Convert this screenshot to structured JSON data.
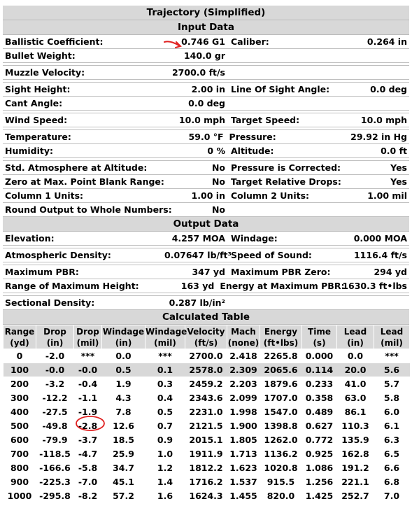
{
  "title": "Trajectory (Simplified)",
  "input": {
    "header": "Input Data",
    "rows": [
      [
        "Ballistic Coefficient:",
        "0.746 G1",
        "Caliber:",
        "0.264 in"
      ],
      [
        "Bullet Weight:",
        "140.0 gr",
        "",
        ""
      ],
      [
        "Muzzle Velocity:",
        "2700.0 ft/s",
        "",
        ""
      ],
      [
        "Sight Height:",
        "2.00 in",
        "Line Of Sight Angle:",
        "0.0 deg"
      ],
      [
        "Cant Angle:",
        "0.0 deg",
        "",
        ""
      ],
      [
        "Wind Speed:",
        "10.0 mph",
        "Target Speed:",
        "10.0 mph"
      ],
      [
        "Temperature:",
        "59.0 °F",
        "Pressure:",
        "29.92 in Hg"
      ],
      [
        "Humidity:",
        "0 %",
        "Altitude:",
        "0.0 ft"
      ],
      [
        "Std. Atmosphere at Altitude:",
        "No",
        "Pressure is Corrected:",
        "Yes"
      ],
      [
        "Zero at Max. Point Blank Range:",
        "No",
        "Target Relative Drops:",
        "Yes"
      ],
      [
        "Column 1 Units:",
        "1.00 in",
        "Column 2 Units:",
        "1.00 mil"
      ],
      [
        "Round Output to Whole Numbers:",
        "No",
        "",
        ""
      ]
    ]
  },
  "output": {
    "header": "Output Data",
    "rows": [
      [
        "Elevation:",
        "4.257 MOA",
        "Windage:",
        "0.000 MOA"
      ],
      [
        "Atmospheric Density:",
        "0.07647 lb/ft³",
        "Speed of Sound:",
        "1116.4 ft/s"
      ],
      [
        "Maximum PBR:",
        "347 yd",
        "Maximum PBR Zero:",
        "294 yd"
      ],
      [
        "Range of Maximum Height:",
        "163 yd",
        "Energy at Maximum PBR:",
        "1630.3 ft•lbs"
      ],
      [
        "Sectional Density:",
        "0.287 lb/in²",
        "",
        ""
      ]
    ]
  },
  "calc": {
    "header": "Calculated Table",
    "columns": [
      [
        "Range",
        "(yd)"
      ],
      [
        "Drop",
        "(in)"
      ],
      [
        "Drop",
        "(mil)"
      ],
      [
        "Windage",
        "(in)"
      ],
      [
        "Windage",
        "(mil)"
      ],
      [
        "Velocity",
        "(ft/s)"
      ],
      [
        "Mach",
        "(none)"
      ],
      [
        "Energy",
        "(ft•lbs)"
      ],
      [
        "Time",
        "(s)"
      ],
      [
        "Lead",
        "(in)"
      ],
      [
        "Lead",
        "(mil)"
      ]
    ],
    "rows": [
      [
        "0",
        "-2.0",
        "***",
        "0.0",
        "***",
        "2700.0",
        "2.418",
        "2265.8",
        "0.000",
        "0.0",
        "***"
      ],
      [
        "100",
        "-0.0",
        "-0.0",
        "0.5",
        "0.1",
        "2578.0",
        "2.309",
        "2065.6",
        "0.114",
        "20.0",
        "5.6"
      ],
      [
        "200",
        "-3.2",
        "-0.4",
        "1.9",
        "0.3",
        "2459.2",
        "2.203",
        "1879.6",
        "0.233",
        "41.0",
        "5.7"
      ],
      [
        "300",
        "-12.2",
        "-1.1",
        "4.3",
        "0.4",
        "2343.6",
        "2.099",
        "1707.0",
        "0.358",
        "63.0",
        "5.8"
      ],
      [
        "400",
        "-27.5",
        "-1.9",
        "7.8",
        "0.5",
        "2231.0",
        "1.998",
        "1547.0",
        "0.489",
        "86.1",
        "6.0"
      ],
      [
        "500",
        "-49.8",
        "-2.8",
        "12.6",
        "0.7",
        "2121.5",
        "1.900",
        "1398.8",
        "0.627",
        "110.3",
        "6.1"
      ],
      [
        "600",
        "-79.9",
        "-3.7",
        "18.5",
        "0.9",
        "2015.1",
        "1.805",
        "1262.0",
        "0.772",
        "135.9",
        "6.3"
      ],
      [
        "700",
        "-118.5",
        "-4.7",
        "25.9",
        "1.0",
        "1911.9",
        "1.713",
        "1136.2",
        "0.925",
        "162.8",
        "6.5"
      ],
      [
        "800",
        "-166.6",
        "-5.8",
        "34.7",
        "1.2",
        "1812.2",
        "1.623",
        "1020.8",
        "1.086",
        "191.2",
        "6.6"
      ],
      [
        "900",
        "-225.3",
        "-7.0",
        "45.1",
        "1.4",
        "1716.2",
        "1.537",
        "915.5",
        "1.256",
        "221.1",
        "6.8"
      ],
      [
        "1000",
        "-295.8",
        "-8.2",
        "57.2",
        "1.6",
        "1624.3",
        "1.455",
        "820.0",
        "1.425",
        "252.7",
        "7.0"
      ]
    ]
  },
  "annotation_color": "#e02020"
}
